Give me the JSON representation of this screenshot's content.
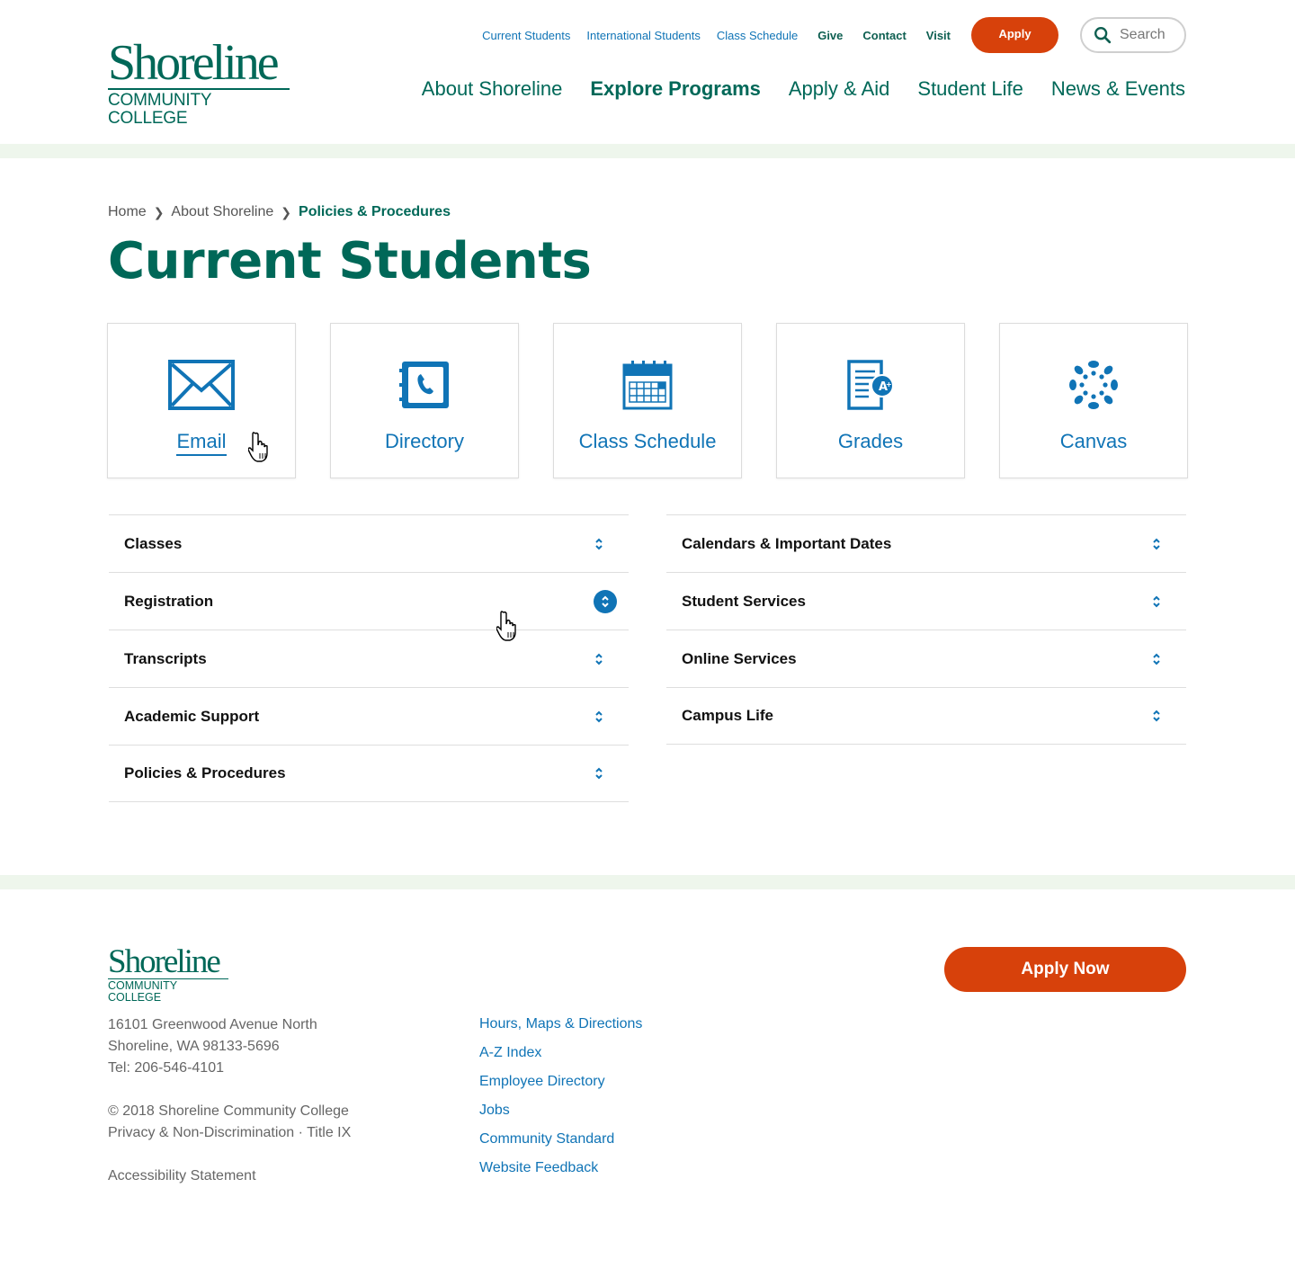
{
  "logo": {
    "brand": "Shoreline",
    "sub": "COMMUNITY COLLEGE"
  },
  "utility": {
    "links": [
      "Current Students",
      "International Students",
      "Class Schedule"
    ],
    "strong_links": [
      "Give",
      "Contact",
      "Visit"
    ],
    "apply_label": "Apply",
    "search_placeholder": "Search"
  },
  "mainnav": [
    "About Shoreline",
    "Explore Programs",
    "Apply & Aid",
    "Student Life",
    "News & Events"
  ],
  "breadcrumb": {
    "home": "Home",
    "parent": "About Shoreline",
    "current": "Policies & Procedures"
  },
  "page_title": "Current Students",
  "cards": [
    {
      "label": "Email",
      "icon": "envelope-icon"
    },
    {
      "label": "Directory",
      "icon": "phone-book-icon"
    },
    {
      "label": "Class Schedule",
      "icon": "calendar-icon"
    },
    {
      "label": "Grades",
      "icon": "grade-report-icon"
    },
    {
      "label": "Canvas",
      "icon": "canvas-logo-icon"
    }
  ],
  "accordion_left": [
    "Classes",
    "Registration",
    "Transcripts",
    "Academic Support",
    "Policies & Procedures"
  ],
  "accordion_right": [
    "Calendars & Important Dates",
    "Student Services",
    "Online Services",
    "Campus Life"
  ],
  "footer": {
    "apply_now": "Apply Now",
    "address": [
      "16101 Greenwood Avenue North",
      "Shoreline, WA 98133-5696",
      "Tel: 206-546-4101"
    ],
    "copyright": "© 2018 Shoreline Community College",
    "privacy": "Privacy & Non-Discrimination · Title IX",
    "accessibility": "Accessibility Statement",
    "links": [
      "Hours, Maps & Directions",
      "A-Z Index",
      "Employee Directory",
      "Jobs",
      "Community Standard",
      "Website Feedback"
    ]
  },
  "colors": {
    "primary_green": "#006858",
    "link_blue": "#1074b6",
    "accent_orange": "#d7410b",
    "band_green": "#eef6ec"
  }
}
